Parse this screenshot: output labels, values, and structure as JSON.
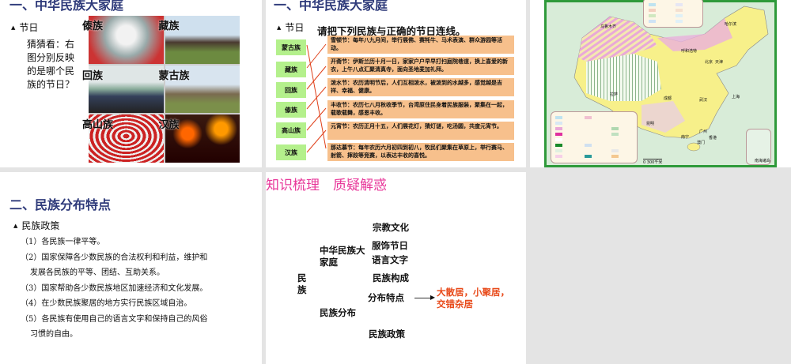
{
  "slide1": {
    "title": "一、中华民族大家庭",
    "bullet": "节日",
    "question": "猜猜看：右图分别反映的是哪个民族的节日？",
    "photo_labels": [
      "傣族",
      "藏族",
      "回族",
      "蒙古族",
      "高山族",
      "汉族"
    ]
  },
  "slide2": {
    "title": "一、中华民族大家庭",
    "bullet": "节日",
    "instruction": "请把下列民族与正确的节日连线。",
    "nationalities": [
      "蒙古族",
      "藏族",
      "回族",
      "傣族",
      "高山族",
      "汉族"
    ],
    "festivals": [
      "雪顿节：每年八九月间，举行展佛、赛牦牛、马术表演、群众游园等活动。",
      "开斋节：伊斯兰历十月一日，家家户户早早打扫庭院巷道，换上喜爱的新衣，上午八点汇聚清真寺，面向圣地麦加礼拜。",
      "泼水节：农历清明节后，人们互相泼水，被泼到的水越多，感觉越是吉祥、幸福、健康。",
      "丰收节：农历七八月秋收季节，台湾原住民身着民族服装，聚集在一起，载歌载舞，感恩丰收。",
      "元宵节：农历正月十五，人们展花灯，猜灯谜，吃汤圆，共度元宵节。",
      "那达慕节：每年农历六月初四到初八，牧民们聚集在草原上，举行赛马、射箭、摔跤等竞赛，以表达丰收的喜悦。"
    ],
    "line_color": "#e0401a"
  },
  "slide3": {
    "map_cities": [
      "哈尔滨",
      "乌鲁木齐",
      "呼和浩特",
      "北京",
      "天津",
      "拉萨",
      "成都",
      "武汉",
      "上海",
      "昆明",
      "南宁",
      "广州",
      "香港",
      "澳门"
    ],
    "scale_label": "0    300千米",
    "inset_label": "南海诸岛"
  },
  "slide4": {
    "title": "二、民族分布特点",
    "bullet": "民族政策",
    "items": [
      "（1）各民族一律平等。",
      "（2）国家保障各少数民族的合法权利和利益，维护和",
      "发展各民族的平等、团结、互助关系。",
      "（3）国家帮助各少数民族地区加速经济和文化发展。",
      "（4）在少数民族聚居的地方实行民族区域自治。",
      "（5）各民族有使用自己的语言文字和保持自己的风俗",
      "习惯的自由。"
    ]
  },
  "slide5": {
    "heading": "知识梳理　质疑解惑",
    "root": "民族",
    "branch1": "中华民族大家庭",
    "branch2": "民族分布",
    "leaves": [
      "宗教文化",
      "服饰节日",
      "语言文字",
      "民族构成",
      "分布特点",
      "民族政策"
    ],
    "distribution": "大散居，小聚居，交错杂居",
    "accent_color": "#e84a1a"
  }
}
